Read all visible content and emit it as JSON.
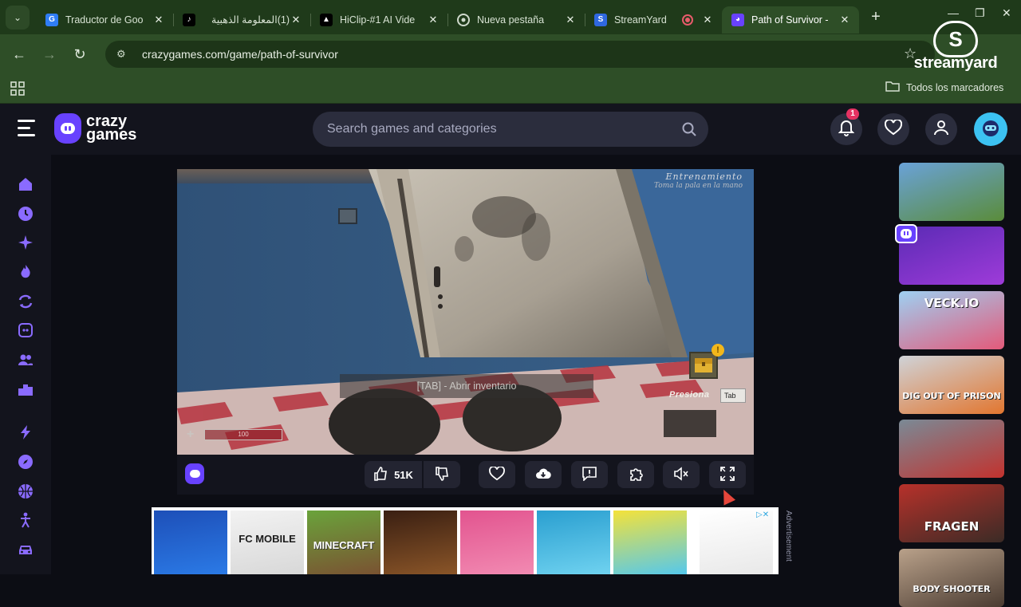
{
  "browser": {
    "tabs": [
      {
        "title": "Traductor de Goo",
        "favicon": "google-translate-icon",
        "active": false
      },
      {
        "title": "(1)المعلومة الذهبية",
        "favicon": "tiktok-icon",
        "active": false
      },
      {
        "title": "HiClip-#1 AI Vide",
        "favicon": "hiclip-icon",
        "active": false
      },
      {
        "title": "Nueva pestaña",
        "favicon": "chrome-icon",
        "active": false
      },
      {
        "title": "StreamYard",
        "favicon": "streamyard-icon",
        "active": false,
        "recording": true
      },
      {
        "title": "Path of Survivor - ",
        "favicon": "crazygames-icon",
        "active": true
      }
    ],
    "url": "crazygames.com/game/path-of-survivor",
    "bookmarks_label": "Todos los marcadores",
    "watermark": "streamyard"
  },
  "site": {
    "logo_line1": "crazy",
    "logo_line2": "games",
    "search_placeholder": "Search games and categories",
    "notification_count": "1",
    "accent": "#6842ff"
  },
  "sidebar_icons": [
    "home-icon",
    "recent-icon",
    "new-icon",
    "trending-icon",
    "updated-icon",
    "originals-icon",
    "multiplayer-icon",
    "leaderboard-icon",
    "action-icon",
    "adventure-icon",
    "basketball-icon",
    "stickman-icon",
    "car-icon"
  ],
  "game": {
    "hud_title": "Entrenamiento",
    "hud_subtitle": "Toma la pala en la mano",
    "hint": "[TAB] - Abrir inventario",
    "press_label": "Presiona",
    "key_label": "Tab",
    "inventory_alert": "!",
    "health_value": "100"
  },
  "toolbar": {
    "likes": "51K"
  },
  "rail_games": [
    {
      "label": "",
      "colors": [
        "#6aa2d8",
        "#5a8c3a"
      ]
    },
    {
      "label": "",
      "colors": [
        "#5b2bb5",
        "#9e3bd9"
      ]
    },
    {
      "label": "VECK.IO",
      "colors": [
        "#9ed0f2",
        "#e35a7a"
      ]
    },
    {
      "label": "DIG OUT OF PRISON",
      "colors": [
        "#cfd3d8",
        "#e2762f"
      ]
    },
    {
      "label": "",
      "colors": [
        "#7a8a96",
        "#c2322e"
      ]
    },
    {
      "label": "FRAGEN",
      "colors": [
        "#b7312a",
        "#3b2b26"
      ]
    },
    {
      "label": "BODY SHOOTER",
      "colors": [
        "#b9a18a",
        "#4a3b31"
      ]
    }
  ],
  "ads": [
    {
      "label": "",
      "colors": [
        "#1d4fb8",
        "#2b7ae6"
      ]
    },
    {
      "label": "FC MOBILE",
      "colors": [
        "#f2f2f2",
        "#d8d8d8"
      ]
    },
    {
      "label": "MINECRAFT",
      "colors": [
        "#6aa33b",
        "#7a5232"
      ]
    },
    {
      "label": "",
      "colors": [
        "#3a1f12",
        "#8a5528"
      ]
    },
    {
      "label": "",
      "colors": [
        "#e2548f",
        "#f28ab2"
      ]
    },
    {
      "label": "",
      "colors": [
        "#2a9fd0",
        "#6fd2f0"
      ]
    },
    {
      "label": "",
      "colors": [
        "#f4e23a",
        "#55c8ec"
      ]
    },
    {
      "label": "",
      "colors": [
        "#ffffff",
        "#e8e8e8"
      ]
    }
  ],
  "ad_label": "Advertisement"
}
